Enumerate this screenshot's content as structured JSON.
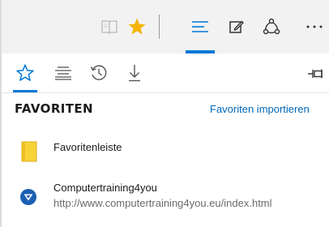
{
  "toolbar": {
    "buttons": [
      {
        "name": "reading-view",
        "icon": "book-icon"
      },
      {
        "name": "add-favorite",
        "icon": "star-filled-icon",
        "color": "#f4b400"
      },
      {
        "name": "hub",
        "icon": "hub-lines-icon",
        "color": "#0078d7",
        "active": true
      },
      {
        "name": "web-note",
        "icon": "pen-square-icon"
      },
      {
        "name": "share",
        "icon": "share-icon"
      },
      {
        "name": "more",
        "icon": "more-dots-icon",
        "label": "···"
      }
    ]
  },
  "hub": {
    "tabs": [
      {
        "name": "favorites",
        "icon": "star-outline-icon",
        "active": true
      },
      {
        "name": "reading-list",
        "icon": "reading-list-icon"
      },
      {
        "name": "history",
        "icon": "history-icon"
      },
      {
        "name": "downloads",
        "icon": "download-icon"
      }
    ],
    "pin_icon": "pin-icon",
    "section_title": "FAVORITEN",
    "import_link": "Favoriten importieren",
    "items": [
      {
        "type": "folder",
        "label": "Favoritenleiste",
        "icon": "folder-icon",
        "icon_color": "#f7d33a"
      },
      {
        "type": "site",
        "title": "Computertraining4you",
        "url": "http://www.computertraining4you.eu/index.html",
        "icon": "site-favicon-icon",
        "icon_color": "#1d5fb4"
      }
    ]
  },
  "colors": {
    "accent": "#0078d7",
    "star": "#f4b400",
    "toolbar_bg": "#f2f2f2",
    "link": "#0067b8"
  }
}
